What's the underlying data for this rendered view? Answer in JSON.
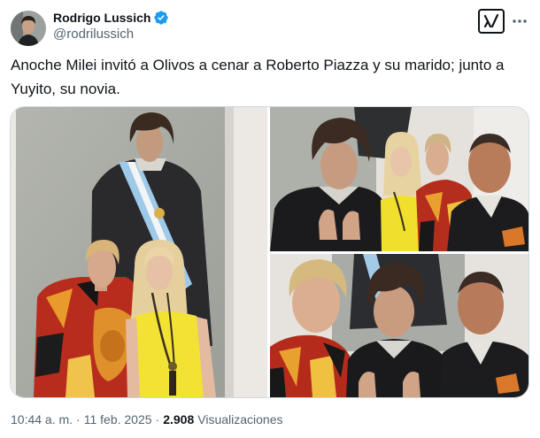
{
  "author": {
    "name": "Rodrigo Lussich",
    "handle": "@rodrilussich"
  },
  "icons": {
    "verified": "verified-badge-icon",
    "grok": "grok-icon",
    "more": "more-horizontal-icon"
  },
  "tweet": {
    "text": "Anoche Milei invitó a Olivos a cenar a Roberto Piazza y su marido; junto a Yuyito, su novia."
  },
  "meta": {
    "time": "10:44 a. m.",
    "separator": "·",
    "date": "11 feb. 2025",
    "views_count": "2.908",
    "views_label": "Visualizaciones"
  },
  "colors": {
    "text_primary": "#0f1419",
    "text_secondary": "#536471",
    "verified_blue": "#1d9bf0",
    "media_border": "#cfd9de",
    "background": "#ffffff"
  }
}
